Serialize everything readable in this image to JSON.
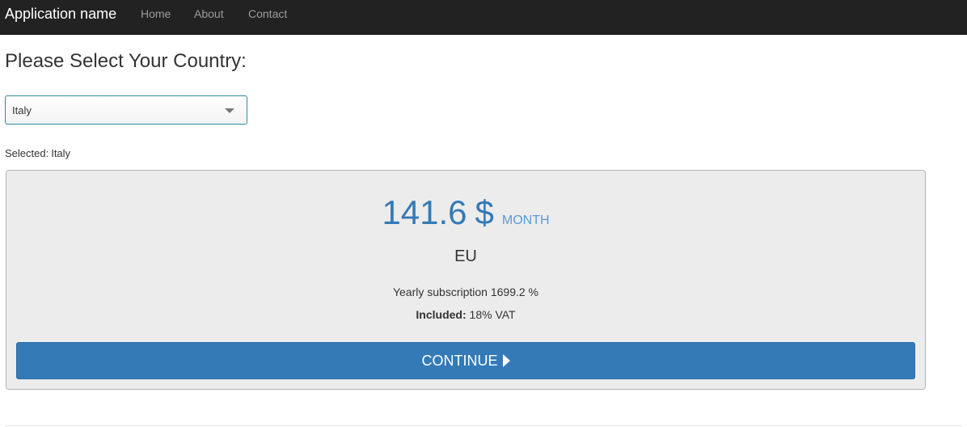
{
  "navbar": {
    "brand": "Application name",
    "links": [
      "Home",
      "About",
      "Contact"
    ]
  },
  "page": {
    "title": "Please Select Your Country:"
  },
  "country_select": {
    "value": "Italy",
    "selected_label": "Selected:",
    "selected_value": "Italy"
  },
  "pricing": {
    "amount": "141.6",
    "currency": "$",
    "period": "MONTH",
    "region": "EU",
    "yearly_text": "Yearly subscription 1699.2 %",
    "included_label": "Included:",
    "included_value": "18% VAT",
    "continue_label": "CONTINUE"
  },
  "colors": {
    "navbar_bg": "#222222",
    "accent": "#337ab7",
    "panel_bg": "#ececec"
  },
  "icons": {
    "select": "chevron-down-icon",
    "continue": "play-icon"
  }
}
